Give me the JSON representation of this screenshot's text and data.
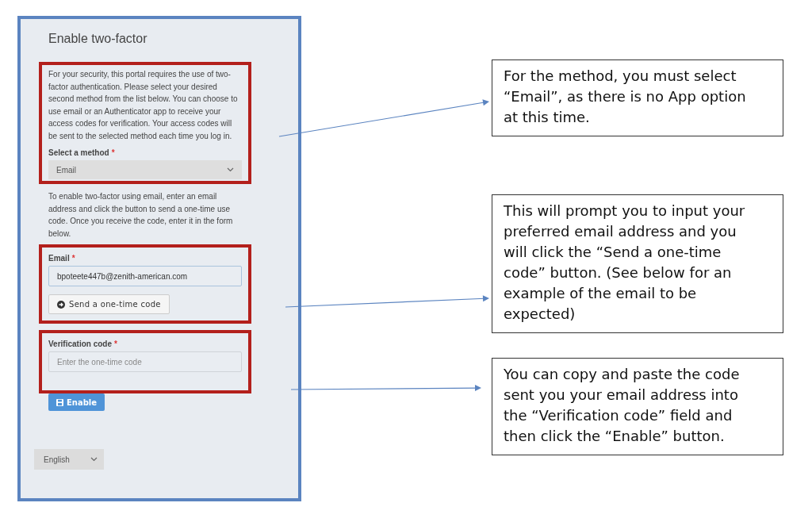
{
  "form": {
    "title": "Enable two-factor",
    "intro": "For your security, this portal requires the use of two-factor authentication. Please select your desired second method from the list below. You can choose to use email or an Authenticator app to receive your access codes for verification. Your access codes will be sent to the selected method each time you log in.",
    "method": {
      "label": "Select a method",
      "required_mark": "*",
      "value": "Email"
    },
    "email_help": "To enable two-factor using email, enter an email address and click the button to send a one-time use code. Once you receive the code, enter it in the form below.",
    "email": {
      "label": "Email",
      "required_mark": "*",
      "value": "bpoteete447b@zenith-american.com"
    },
    "send_button": "Send a one-time code",
    "code": {
      "label": "Verification code",
      "required_mark": "*",
      "placeholder": "Enter the one-time code"
    },
    "enable_button": "Enable"
  },
  "language": {
    "value": "English"
  },
  "callouts": [
    "For the method, you must select “Email”, as there is no App option at this time.",
    "This will prompt you to input your preferred email address and you will click the “Send a one-time code” button. (See below for an example of the email to be expected)",
    "You can copy and paste the code sent you your email address into the “Verification code” field and then click the “Enable” button."
  ]
}
